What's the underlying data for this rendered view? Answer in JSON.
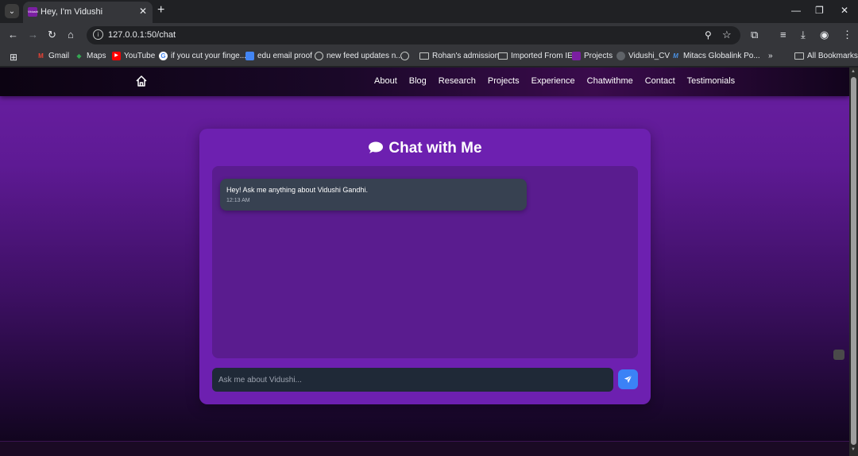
{
  "browser": {
    "tab_title": "Hey, I'm Vidushi",
    "favicon_text": "Vidushi",
    "url": "127.0.0.1:50/chat",
    "bookmarks": [
      {
        "label": "Gmail",
        "icon": "gmail-icon"
      },
      {
        "label": "Maps",
        "icon": "maps-icon"
      },
      {
        "label": "YouTube",
        "icon": "youtube-icon"
      },
      {
        "label": "if you cut your finge...",
        "icon": "google-icon"
      },
      {
        "label": "edu email proof",
        "icon": "doc-icon"
      },
      {
        "label": "new feed updates n...",
        "icon": "globe-icon"
      },
      {
        "label": "",
        "icon": "globe-icon"
      },
      {
        "label": "Rohan's admission",
        "icon": "folder-icon"
      },
      {
        "label": "Imported From IE",
        "icon": "folder-icon"
      },
      {
        "label": "Projects",
        "icon": "site-icon"
      },
      {
        "label": "Vidushi_CV",
        "icon": "cv-icon"
      },
      {
        "label": "Mitacs Globalink Po...",
        "icon": "mitacs-icon"
      }
    ],
    "overflow_label": "»",
    "all_bookmarks": "All Bookmarks"
  },
  "site": {
    "nav_links": [
      "About",
      "Blog",
      "Research",
      "Projects",
      "Experience",
      "Chatwithme",
      "Contact",
      "Testimonials"
    ]
  },
  "chat": {
    "title": "Chat with Me",
    "messages": [
      {
        "text": "Hey! Ask me anything about Vidushi Gandhi.",
        "time": "12:13 AM"
      }
    ],
    "input_placeholder": "Ask me about Vidushi..."
  },
  "colors": {
    "card": "#6d20b0",
    "chat_area": "#5a1c8f",
    "bubble": "#374151",
    "send_button": "#3b82f6"
  }
}
